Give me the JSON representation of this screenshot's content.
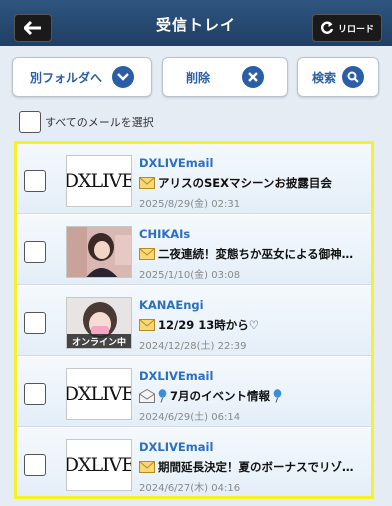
{
  "header": {
    "title": "受信トレイ",
    "reload_label": "リロード"
  },
  "toolbar": {
    "move_label": "別フォルダへ",
    "delete_label": "削除",
    "search_label": "検索"
  },
  "select_all_label": "すべてのメールを選択",
  "mails": [
    {
      "sender": "DXLIVEmail",
      "subject": "アリスのSEXマシーンお披露目会",
      "date": "2025/8/29(金) 02:31",
      "thumb": "dxlive-logo",
      "thumb_text": "DXLIVE",
      "icon": "envelope-closed-icon"
    },
    {
      "sender": "CHIKAIs",
      "subject": "二夜連続！変態ちか巫女による御神…",
      "date": "2025/1/10(金) 03:08",
      "thumb": "photo",
      "icon": "envelope-closed-icon"
    },
    {
      "sender": "KANAEngi",
      "subject": "12/29 13時から♡",
      "date": "2024/12/28(土) 22:39",
      "thumb": "photo-online",
      "badge": "オンライン中",
      "icon": "envelope-closed-icon"
    },
    {
      "sender": "DXLIVEmail",
      "subject": "7月のイベント情報",
      "date": "2024/6/29(土) 06:14",
      "thumb": "dxlive-logo",
      "thumb_text": "DXLIVE",
      "icon": "envelope-open-icon"
    },
    {
      "sender": "DXLIVEmail",
      "subject": "期間延長決定！夏のボーナスでリゾ…",
      "date": "2024/6/27(木) 04:16",
      "thumb": "dxlive-logo",
      "thumb_text": "DXLIVE",
      "icon": "envelope-closed-icon"
    }
  ],
  "colors": {
    "header": "#24466e",
    "accent": "#2a5ea8",
    "sender": "#2a6fc4",
    "highlight_border": "#f6f22a"
  }
}
